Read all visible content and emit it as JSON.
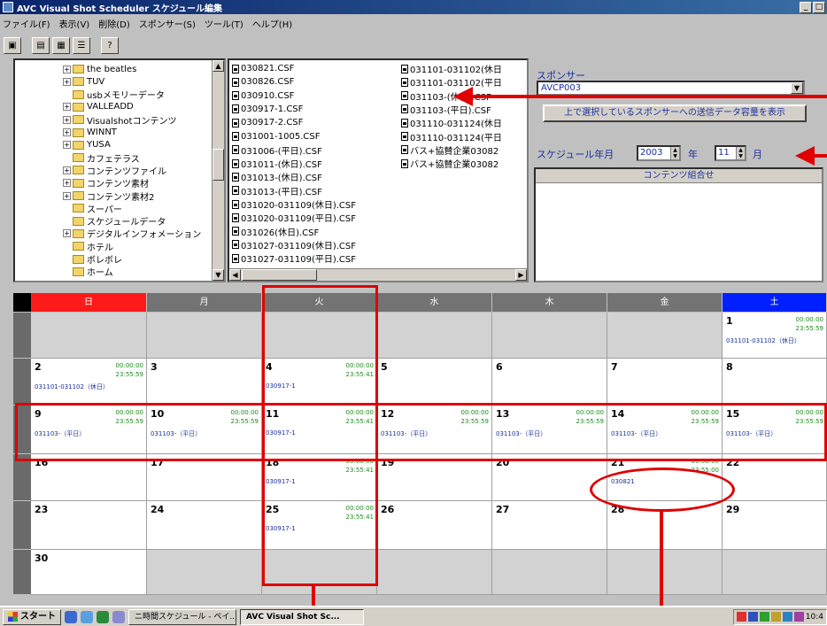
{
  "window": {
    "title": "AVC Visual Shot Scheduler スケジュール編集"
  },
  "menu": [
    "ファイル(F)",
    "表示(V)",
    "削除(D)",
    "スポンサー(S)",
    "ツール(T)",
    "ヘルプ(H)"
  ],
  "toolbar": {
    "buttons": [
      {
        "icon": "save-icon"
      },
      {
        "icon": "tile-icon"
      },
      {
        "icon": "grid-icon"
      },
      {
        "icon": "list-icon"
      },
      {
        "icon": "help-icon"
      }
    ]
  },
  "tree": {
    "items": [
      {
        "label": "the beatles",
        "indent": 1,
        "expander": "+"
      },
      {
        "label": "TUV",
        "indent": 1,
        "expander": "+"
      },
      {
        "label": "usbメモリーデータ",
        "indent": 1,
        "expander": ""
      },
      {
        "label": "VALLEADD",
        "indent": 1,
        "expander": "+"
      },
      {
        "label": "Visualshotコンテンツ",
        "indent": 1,
        "expander": "+"
      },
      {
        "label": "WINNT",
        "indent": 1,
        "expander": "+"
      },
      {
        "label": "YUSA",
        "indent": 1,
        "expander": "+"
      },
      {
        "label": "カフェテラス",
        "indent": 1,
        "expander": ""
      },
      {
        "label": "コンテンツファイル",
        "indent": 1,
        "expander": "+"
      },
      {
        "label": "コンテンツ素材",
        "indent": 1,
        "expander": "+"
      },
      {
        "label": "コンテンツ素材2",
        "indent": 1,
        "expander": "+"
      },
      {
        "label": "スーパー",
        "indent": 1,
        "expander": ""
      },
      {
        "label": "スケジュールデータ",
        "indent": 1,
        "expander": ""
      },
      {
        "label": "デジタルインフォメーション",
        "indent": 1,
        "expander": "+"
      },
      {
        "label": "ホテル",
        "indent": 1,
        "expander": ""
      },
      {
        "label": "ボレボレ",
        "indent": 1,
        "expander": ""
      },
      {
        "label": "ホーム",
        "indent": 1,
        "expander": ""
      }
    ]
  },
  "files": {
    "col1": [
      "030821.CSF",
      "030826.CSF",
      "030910.CSF",
      "030917-1.CSF",
      "030917-2.CSF",
      "031001-1005.CSF",
      "031006-(平日).CSF",
      "031011-(休日).CSF",
      "031013-(休日).CSF",
      "031013-(平日).CSF",
      "031020-031109(休日).CSF",
      "031020-031109(平日).CSF",
      "031026(休日).CSF",
      "031027-031109(休日).CSF",
      "031027-031109(平日).CSF"
    ],
    "col2": [
      "031101-031102(休日",
      "031101-031102(平日",
      "031103-(休日).CSF",
      "031103-(平日).CSF",
      "031110-031124(休日",
      "031110-031124(平日",
      "バス+協賛企業03082",
      "バス+協賛企業03082"
    ]
  },
  "sponsor": {
    "label": "スポンサー",
    "selected": "AVCP003",
    "show_button": "上で選択しているスポンサーへの送信データ容量を表示"
  },
  "schedule": {
    "label": "スケジュール年月",
    "year": "2003",
    "year_unit": "年",
    "month": "11",
    "month_unit": "月",
    "contents_header": "コンテンツ組合せ"
  },
  "calendar": {
    "headers": [
      "日",
      "月",
      "火",
      "水",
      "木",
      "金",
      "土"
    ],
    "header_colors": [
      "#ff1a1a",
      "#737373",
      "#737373",
      "#737373",
      "#737373",
      "#737373",
      "#0020ff"
    ],
    "weeks": [
      [
        null,
        null,
        null,
        null,
        null,
        null,
        {
          "day": "1",
          "t1": "00:00:00",
          "t2": "23:55:59",
          "file": "031101-031102（休日）"
        }
      ],
      [
        {
          "day": "2",
          "t1": "00:00:00",
          "t2": "23:55:59",
          "file": "031101-031102（休日）"
        },
        {
          "day": "3"
        },
        {
          "day": "4",
          "t1": "00:00:00",
          "t2": "23:55:41",
          "file": "030917-1"
        },
        {
          "day": "5"
        },
        {
          "day": "6"
        },
        {
          "day": "7"
        },
        {
          "day": "8"
        }
      ],
      [
        {
          "day": "9",
          "t1": "00:00:00",
          "t2": "23:55:59",
          "file": "031103-（平日）"
        },
        {
          "day": "10",
          "t1": "00:00:00",
          "t2": "23:55:59",
          "file": "031103-（平日）"
        },
        {
          "day": "11",
          "t1": "00:00:00",
          "t2": "23:55:41",
          "file": "030917-1"
        },
        {
          "day": "12",
          "t1": "00:00:00",
          "t2": "23:55:59",
          "file": "031103-（平日）"
        },
        {
          "day": "13",
          "t1": "00:00:00",
          "t2": "23:55:59",
          "file": "031103-（平日）"
        },
        {
          "day": "14",
          "t1": "00:00:00",
          "t2": "23:55:59",
          "file": "031103-（平日）"
        },
        {
          "day": "15",
          "t1": "00:00:00",
          "t2": "23:55:59",
          "file": "031103-（平日）"
        }
      ],
      [
        {
          "day": "16"
        },
        {
          "day": "17"
        },
        {
          "day": "18",
          "t1": "00:00:00",
          "t2": "23:55:41",
          "file": "030917-1"
        },
        {
          "day": "19"
        },
        {
          "day": "20"
        },
        {
          "day": "21",
          "t1": "00:00:00",
          "t2": "23:55:00",
          "file": "030821"
        },
        {
          "day": "22"
        }
      ],
      [
        {
          "day": "23"
        },
        {
          "day": "24"
        },
        {
          "day": "25",
          "t1": "00:00:00",
          "t2": "23:55:41",
          "file": "030917-1"
        },
        {
          "day": "26"
        },
        {
          "day": "27"
        },
        {
          "day": "28"
        },
        {
          "day": "29"
        }
      ],
      [
        {
          "day": "30"
        },
        null,
        null,
        null,
        null,
        null,
        null
      ]
    ]
  },
  "taskbar": {
    "start": "スタート",
    "tasks": [
      "ニ時間スケジュール - ペイ...",
      "AVC Visual Shot Sc..."
    ],
    "clock": "10:4"
  },
  "colors": {
    "accent_text": "#1a2fa0",
    "annotation": "#e00000",
    "sunday": "#ff1a1a",
    "saturday": "#0020ff"
  }
}
